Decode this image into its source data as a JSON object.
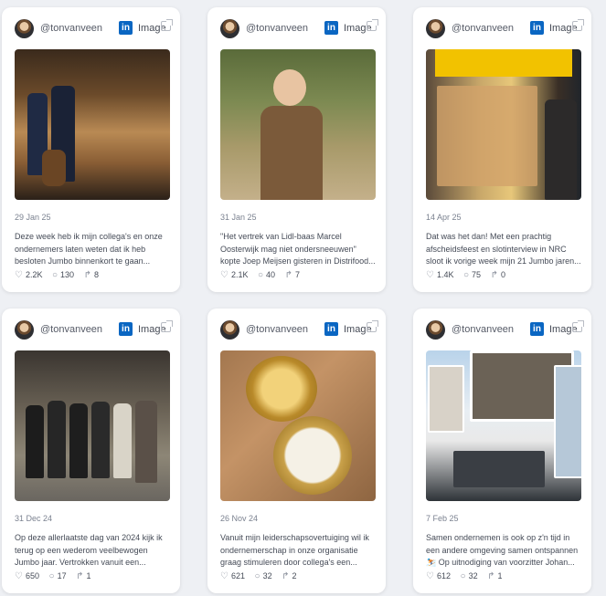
{
  "cards": [
    {
      "handle": "@tonvanveen",
      "type": "Image",
      "date": "29 Jan 25",
      "text": "Deze week heb ik mijn collega's en onze ondernemers laten weten dat ik heb besloten Jumbo binnenkort te gaan...",
      "likes": "2.2K",
      "comments": "130",
      "shares": "8"
    },
    {
      "handle": "@tonvanveen",
      "type": "Image",
      "date": "31 Jan 25",
      "text": "\"Het vertrek van Lidl-baas Marcel Oosterwijk mag niet ondersneeuwen\" kopte Joep Meijsen gisteren in Distrifood...",
      "likes": "2.1K",
      "comments": "40",
      "shares": "7"
    },
    {
      "handle": "@tonvanveen",
      "type": "Image",
      "date": "14 Apr 25",
      "text": "Dat was het dan! Met een prachtig afscheidsfeest en slotinterview in NRC sloot ik vorige week mijn 21 Jumbo jaren...",
      "likes": "1.4K",
      "comments": "75",
      "shares": "0"
    },
    {
      "handle": "@tonvanveen",
      "type": "Image",
      "date": "31 Dec 24",
      "text": "Op deze allerlaatste dag van 2024 kijk ik terug op een wederom veelbewogen Jumbo jaar. Vertrokken vanuit een...",
      "likes": "650",
      "comments": "17",
      "shares": "1"
    },
    {
      "handle": "@tonvanveen",
      "type": "Image",
      "date": "26 Nov 24",
      "text": "Vanuit mijn leiderschapsovertuiging wil ik ondernemerschap in onze organisatie graag stimuleren door collega's een...",
      "likes": "621",
      "comments": "32",
      "shares": "2"
    },
    {
      "handle": "@tonvanveen",
      "type": "Image",
      "date": "7 Feb 25",
      "text": "Samen ondernemen is ook op z'n tijd in een andere omgeving samen ontspannen ⛷️ Op uitnodiging van voorzitter Johan...",
      "likes": "612",
      "comments": "32",
      "shares": "1"
    }
  ],
  "icons": {
    "platform": "linkedin-icon",
    "likes": "heart-icon",
    "comments": "comment-icon",
    "shares": "share-icon"
  },
  "colors": {
    "linkedin": "#0a66c2",
    "background": "#eef0f4",
    "card": "#ffffff"
  }
}
